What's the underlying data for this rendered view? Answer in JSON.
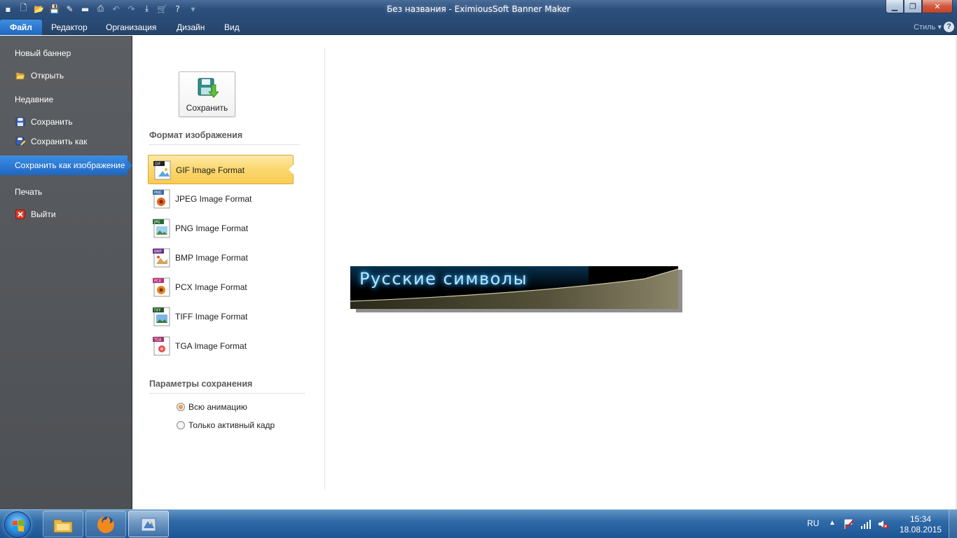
{
  "window": {
    "title": "Без названия - EximiousSoft Banner Maker"
  },
  "menubar": {
    "items": [
      "Файл",
      "Редактор",
      "Организация",
      "Дизайн",
      "Вид"
    ],
    "style_label": "Стиль"
  },
  "backstage": {
    "items": [
      {
        "label": "Новый баннер",
        "icon": "none"
      },
      {
        "label": "Открыть",
        "icon": "folder-icon"
      },
      {
        "label": "Недавние",
        "icon": "none"
      },
      {
        "label": "Сохранить",
        "icon": "floppy-icon"
      },
      {
        "label": "Сохранить как",
        "icon": "save-as-icon"
      },
      {
        "label": "Сохранить как изображение",
        "icon": "none",
        "selected": true
      },
      {
        "label": "Печать",
        "icon": "none"
      },
      {
        "label": "Выйти",
        "icon": "exit-icon"
      }
    ]
  },
  "options": {
    "save_button": "Сохранить",
    "format_section_title": "Формат изображения",
    "formats": [
      {
        "label": "GIF Image Format",
        "badge": "GIF",
        "selected": true
      },
      {
        "label": "JPEG Image Format",
        "badge": "PNG"
      },
      {
        "label": "PNG Image Format",
        "badge": "JPG"
      },
      {
        "label": "BMP Image Format",
        "badge": "BMP"
      },
      {
        "label": "PCX Image Format",
        "badge": "PCX"
      },
      {
        "label": "TIFF Image Format",
        "badge": "TIFF"
      },
      {
        "label": "TGA Image Format",
        "badge": "TGA"
      }
    ],
    "save_params_title": "Параметры сохранения",
    "radios": [
      {
        "label": "Всю анимацию",
        "checked": true
      },
      {
        "label": "Только активный кадр",
        "checked": false
      }
    ]
  },
  "preview": {
    "banner_text": "Русские символы"
  },
  "taskbar": {
    "language": "RU",
    "time": "15:34",
    "date": "18.08.2015"
  },
  "colors": {
    "accent_blue": "#1f67c2",
    "selection_yellow": "#fbd873",
    "backstage_gray": "#55585c"
  }
}
